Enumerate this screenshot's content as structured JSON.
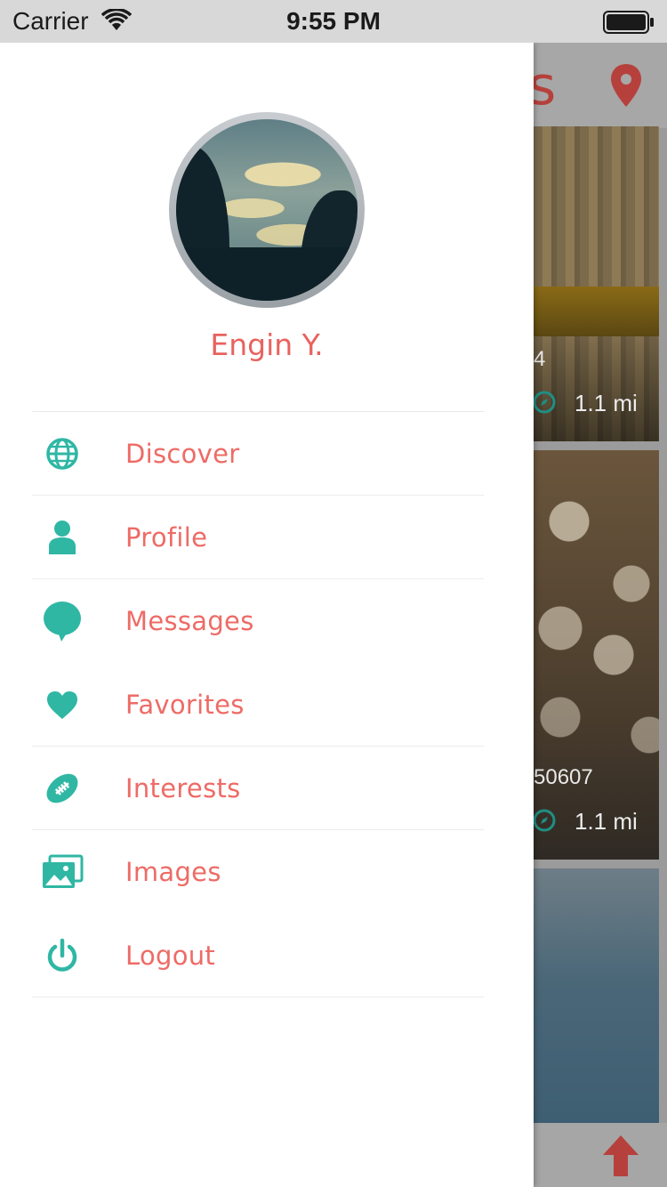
{
  "status_bar": {
    "carrier": "Carrier",
    "time": "9:55 PM"
  },
  "background": {
    "title_fragment": "s",
    "cards": [
      {
        "meta": "4",
        "distance": "1.1 mi"
      },
      {
        "meta": "50607",
        "distance": "1.1 mi"
      }
    ]
  },
  "drawer": {
    "user_name": "Engin Y.",
    "menu": [
      {
        "label": "Discover",
        "icon": "globe-icon"
      },
      {
        "label": "Profile",
        "icon": "person-icon"
      },
      {
        "label": "Messages",
        "icon": "chat-bubble-icon"
      },
      {
        "label": "Favorites",
        "icon": "heart-icon"
      },
      {
        "label": "Interests",
        "icon": "football-icon"
      },
      {
        "label": "Images",
        "icon": "images-icon"
      },
      {
        "label": "Logout",
        "icon": "power-icon"
      }
    ]
  },
  "colors": {
    "accent_text": "#ee6b66",
    "icon_teal": "#2fb7a4",
    "bg_accent": "#b6413c"
  }
}
